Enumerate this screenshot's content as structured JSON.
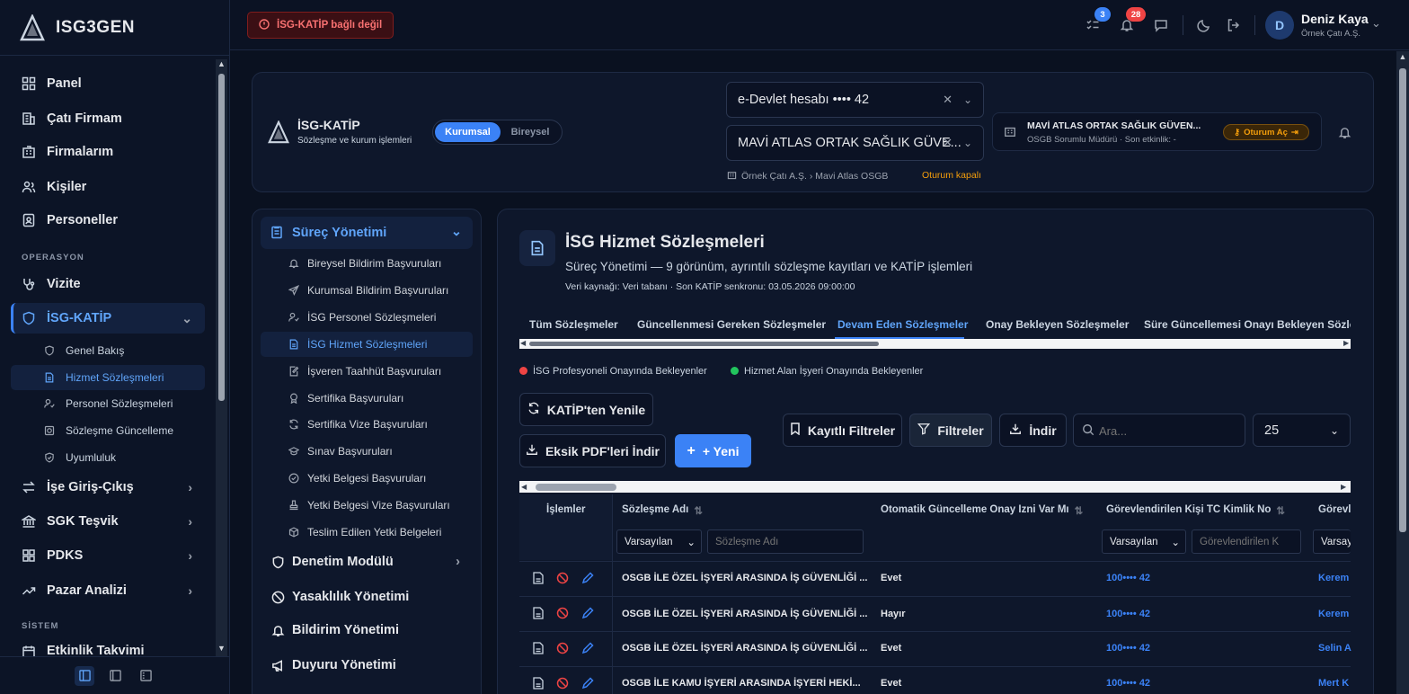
{
  "app": {
    "name": "ISG3GEN"
  },
  "sidebar": {
    "items": [
      {
        "label": "Panel",
        "icon": "grid-icon"
      },
      {
        "label": "Çatı Firmam",
        "icon": "building-icon"
      },
      {
        "label": "Firmalarım",
        "icon": "buildings-icon"
      },
      {
        "label": "Kişiler",
        "icon": "users-icon"
      },
      {
        "label": "Personeller",
        "icon": "id-badge-icon"
      }
    ],
    "section_operasyon": "OPERASYON",
    "vizite": "Vizite",
    "isg_katip": "İSG-KATİP",
    "katip_sub": [
      "Genel Bakış",
      "Hizmet Sözleşmeleri",
      "Personel Sözleşmeleri",
      "Sözleşme Güncelleme",
      "Uyumluluk"
    ],
    "more": [
      "İşe Giriş-Çıkış",
      "SGK Teşvik",
      "PDKS",
      "Pazar Analizi"
    ],
    "section_sistem": "SİSTEM",
    "etkinlik": "Etkinlik Takvimi"
  },
  "topbar": {
    "alert": "İSG-KATİP bağlı değil",
    "tasks_badge": "3",
    "notif_badge": "28",
    "user_initial": "D",
    "user_name": "Deniz Kaya",
    "user_company": "Örnek Çatı A.Ş."
  },
  "header_card": {
    "title": "İSG-KATİP",
    "subtitle": "Sözleşme ve kurum işlemleri",
    "toggle_active": "Kurumsal",
    "toggle_inactive": "Bireysel",
    "account_select": "e-Devlet hesabı •••• 42",
    "company_select": "MAVİ ATLAS ORTAK SAĞLIK GÜVE...",
    "breadcrumb": "Örnek Çatı A.Ş. › Mavi Atlas OSGB",
    "session_status": "Oturum kapalı",
    "session_card_title": "MAVİ ATLAS ORTAK SAĞLIK GÜVEN...",
    "session_card_sub": "OSGB Sorumlu Müdürü · Son etkinlik: -",
    "session_button": "Oturum Aç"
  },
  "left_menu": {
    "section": "Süreç Yönetimi",
    "items": [
      "Bireysel Bildirim Başvuruları",
      "Kurumsal Bildirim Başvuruları",
      "İSG Personel Sözleşmeleri",
      "İSG Hizmet Sözleşmeleri",
      "İşveren Taahhüt Başvuruları",
      "Sertifika Başvuruları",
      "Sertifika Vize Başvuruları",
      "Sınav Başvuruları",
      "Yetki Belgesi Başvuruları",
      "Yetki Belgesi Vize Başvuruları",
      "Teslim Edilen Yetki Belgeleri"
    ],
    "groups": [
      "Denetim Modülü",
      "Yasaklılık Yönetimi",
      "Bildirim Yönetimi",
      "Duyuru Yönetimi"
    ]
  },
  "content": {
    "title": "İSG Hizmet Sözleşmeleri",
    "subtitle": "Süreç Yönetimi — 9 görünüm, ayrıntılı sözleşme kayıtları ve KATİP işlemleri",
    "source": "Veri kaynağı: Veri tabanı · Son KATİP senkronu: 03.05.2026 09:00:00",
    "tabs": [
      "Tüm Sözleşmeler",
      "Güncellenmesi Gereken Sözleşmeler",
      "Devam Eden Sözleşmeler",
      "Onay Bekleyen Sözleşmeler",
      "Süre Güncellemesi Onayı Bekleyen Sözleşm"
    ],
    "legend_red": "İSG Profesyoneli Onayında Bekleyenler",
    "legend_green": "Hizmet Alan İşyeri Onayında Bekleyenler",
    "buttons": {
      "refresh": "KATİP'ten Yenile",
      "missing_pdf": "Eksik PDF'leri İndir",
      "new": "+ Yeni",
      "saved_filters": "Kayıtlı Filtreler",
      "filters": "Filtreler",
      "download": "İndir"
    },
    "search_placeholder": "Ara...",
    "page_size": "25"
  },
  "table": {
    "headers": [
      "İşlemler",
      "Sözleşme Adı",
      "Otomatik Güncelleme Onay İzni Var Mı",
      "Görevlendirilen Kişi TC Kimlik No",
      "Görevl"
    ],
    "filter_default": "Varsayılan",
    "filter_name_placeholder": "Sözleşme Adı",
    "filter_tc_placeholder": "Görevlendirilen K",
    "filter_partial": "Varsay",
    "rows": [
      {
        "name": "OSGB İLE ÖZEL İŞYERİ ARASINDA İŞ GÜVENLİĞİ ...",
        "auto": "Evet",
        "tc": "100•••• 42",
        "person": "Kerem"
      },
      {
        "name": "OSGB İLE ÖZEL İŞYERİ ARASINDA İŞ GÜVENLİĞİ ...",
        "auto": "Hayır",
        "tc": "100•••• 42",
        "person": "Kerem"
      },
      {
        "name": "OSGB İLE ÖZEL İŞYERİ ARASINDA İŞ GÜVENLİĞİ ...",
        "auto": "Evet",
        "tc": "100•••• 42",
        "person": "Selin A"
      },
      {
        "name": "OSGB İLE KAMU İŞYERİ ARASINDA İŞYERİ HEKİ...",
        "auto": "Evet",
        "tc": "100•••• 42",
        "person": "Mert K"
      }
    ]
  },
  "colors": {
    "accent": "#3b82f6",
    "danger": "#ef4444",
    "success": "#22c55e",
    "warning": "#f59e0b",
    "bg": "#0a1120"
  }
}
